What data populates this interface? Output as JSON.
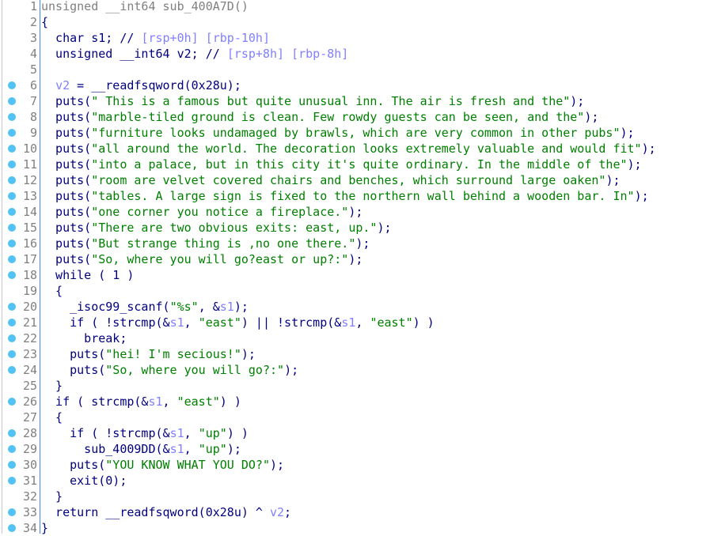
{
  "colors": {
    "code": "#000080",
    "string": "#008000",
    "comment": "#8080ff",
    "variable": "#8080ff",
    "line_number": "#808080",
    "breakpoint_dot": "#52c2f5"
  },
  "lines": [
    {
      "n": "1",
      "dot": false,
      "t": [
        [
          "g",
          "unsigned __int64 sub_400A7D()"
        ]
      ]
    },
    {
      "n": "2",
      "dot": false,
      "t": [
        [
          "k",
          "{"
        ]
      ]
    },
    {
      "n": "3",
      "dot": false,
      "t": [
        [
          "k",
          "  char s1; // "
        ],
        [
          "c",
          "[rsp+0h] [rbp-10h]"
        ]
      ]
    },
    {
      "n": "4",
      "dot": false,
      "t": [
        [
          "k",
          "  unsigned __int64 v2; // "
        ],
        [
          "c",
          "[rsp+8h] [rbp-8h]"
        ]
      ]
    },
    {
      "n": "5",
      "dot": false,
      "t": []
    },
    {
      "n": "6",
      "dot": true,
      "t": [
        [
          "k",
          "  "
        ],
        [
          "v",
          "v2"
        ],
        [
          "k",
          " = __readfsqword(0x28u);"
        ]
      ]
    },
    {
      "n": "7",
      "dot": true,
      "t": [
        [
          "k",
          "  puts("
        ],
        [
          "s",
          "\" This is a famous but quite unusual inn. The air is fresh and the\""
        ],
        [
          "k",
          ");"
        ]
      ]
    },
    {
      "n": "8",
      "dot": true,
      "t": [
        [
          "k",
          "  puts("
        ],
        [
          "s",
          "\"marble-tiled ground is clean. Few rowdy guests can be seen, and the\""
        ],
        [
          "k",
          ");"
        ]
      ]
    },
    {
      "n": "9",
      "dot": true,
      "t": [
        [
          "k",
          "  puts("
        ],
        [
          "s",
          "\"furniture looks undamaged by brawls, which are very common in other pubs\""
        ],
        [
          "k",
          ");"
        ]
      ]
    },
    {
      "n": "10",
      "dot": true,
      "t": [
        [
          "k",
          "  puts("
        ],
        [
          "s",
          "\"all around the world. The decoration looks extremely valuable and would fit\""
        ],
        [
          "k",
          ");"
        ]
      ]
    },
    {
      "n": "11",
      "dot": true,
      "t": [
        [
          "k",
          "  puts("
        ],
        [
          "s",
          "\"into a palace, but in this city it's quite ordinary. In the middle of the\""
        ],
        [
          "k",
          ");"
        ]
      ]
    },
    {
      "n": "12",
      "dot": true,
      "t": [
        [
          "k",
          "  puts("
        ],
        [
          "s",
          "\"room are velvet covered chairs and benches, which surround large oaken\""
        ],
        [
          "k",
          ");"
        ]
      ]
    },
    {
      "n": "13",
      "dot": true,
      "t": [
        [
          "k",
          "  puts("
        ],
        [
          "s",
          "\"tables. A large sign is fixed to the northern wall behind a wooden bar. In\""
        ],
        [
          "k",
          ");"
        ]
      ]
    },
    {
      "n": "14",
      "dot": true,
      "t": [
        [
          "k",
          "  puts("
        ],
        [
          "s",
          "\"one corner you notice a fireplace.\""
        ],
        [
          "k",
          ");"
        ]
      ]
    },
    {
      "n": "15",
      "dot": true,
      "t": [
        [
          "k",
          "  puts("
        ],
        [
          "s",
          "\"There are two obvious exits: east, up.\""
        ],
        [
          "k",
          ");"
        ]
      ]
    },
    {
      "n": "16",
      "dot": true,
      "t": [
        [
          "k",
          "  puts("
        ],
        [
          "s",
          "\"But strange thing is ,no one there.\""
        ],
        [
          "k",
          ");"
        ]
      ]
    },
    {
      "n": "17",
      "dot": true,
      "t": [
        [
          "k",
          "  puts("
        ],
        [
          "s",
          "\"So, where you will go?east or up?:\""
        ],
        [
          "k",
          ");"
        ]
      ]
    },
    {
      "n": "18",
      "dot": true,
      "t": [
        [
          "k",
          "  while ( 1 )"
        ]
      ]
    },
    {
      "n": "19",
      "dot": false,
      "t": [
        [
          "k",
          "  {"
        ]
      ]
    },
    {
      "n": "20",
      "dot": true,
      "t": [
        [
          "k",
          "    _isoc99_scanf("
        ],
        [
          "s",
          "\"%s\""
        ],
        [
          "k",
          ", &"
        ],
        [
          "v",
          "s1"
        ],
        [
          "k",
          ");"
        ]
      ]
    },
    {
      "n": "21",
      "dot": true,
      "t": [
        [
          "k",
          "    if ( !strcmp(&"
        ],
        [
          "v",
          "s1"
        ],
        [
          "k",
          ", "
        ],
        [
          "s",
          "\"east\""
        ],
        [
          "k",
          ") || !strcmp(&"
        ],
        [
          "v",
          "s1"
        ],
        [
          "k",
          ", "
        ],
        [
          "s",
          "\"east\""
        ],
        [
          "k",
          ") )"
        ]
      ]
    },
    {
      "n": "22",
      "dot": true,
      "t": [
        [
          "k",
          "      break;"
        ]
      ]
    },
    {
      "n": "23",
      "dot": true,
      "t": [
        [
          "k",
          "    puts("
        ],
        [
          "s",
          "\"hei! I'm secious!\""
        ],
        [
          "k",
          ");"
        ]
      ]
    },
    {
      "n": "24",
      "dot": true,
      "t": [
        [
          "k",
          "    puts("
        ],
        [
          "s",
          "\"So, where you will go?:\""
        ],
        [
          "k",
          ");"
        ]
      ]
    },
    {
      "n": "25",
      "dot": false,
      "t": [
        [
          "k",
          "  }"
        ]
      ]
    },
    {
      "n": "26",
      "dot": true,
      "t": [
        [
          "k",
          "  if ( strcmp(&"
        ],
        [
          "v",
          "s1"
        ],
        [
          "k",
          ", "
        ],
        [
          "s",
          "\"east\""
        ],
        [
          "k",
          ") )"
        ]
      ]
    },
    {
      "n": "27",
      "dot": false,
      "t": [
        [
          "k",
          "  {"
        ]
      ]
    },
    {
      "n": "28",
      "dot": true,
      "t": [
        [
          "k",
          "    if ( !strcmp(&"
        ],
        [
          "v",
          "s1"
        ],
        [
          "k",
          ", "
        ],
        [
          "s",
          "\"up\""
        ],
        [
          "k",
          ") )"
        ]
      ]
    },
    {
      "n": "29",
      "dot": true,
      "t": [
        [
          "k",
          "      sub_4009DD(&"
        ],
        [
          "v",
          "s1"
        ],
        [
          "k",
          ", "
        ],
        [
          "s",
          "\"up\""
        ],
        [
          "k",
          ");"
        ]
      ]
    },
    {
      "n": "30",
      "dot": true,
      "t": [
        [
          "k",
          "    puts("
        ],
        [
          "s",
          "\"YOU KNOW WHAT YOU DO?\""
        ],
        [
          "k",
          ");"
        ]
      ]
    },
    {
      "n": "31",
      "dot": true,
      "t": [
        [
          "k",
          "    exit(0);"
        ]
      ]
    },
    {
      "n": "32",
      "dot": false,
      "t": [
        [
          "k",
          "  }"
        ]
      ]
    },
    {
      "n": "33",
      "dot": true,
      "t": [
        [
          "k",
          "  return __readfsqword(0x28u) ^ "
        ],
        [
          "v",
          "v2"
        ],
        [
          "k",
          ";"
        ]
      ]
    },
    {
      "n": "34",
      "dot": true,
      "t": [
        [
          "k",
          "}"
        ]
      ]
    }
  ]
}
